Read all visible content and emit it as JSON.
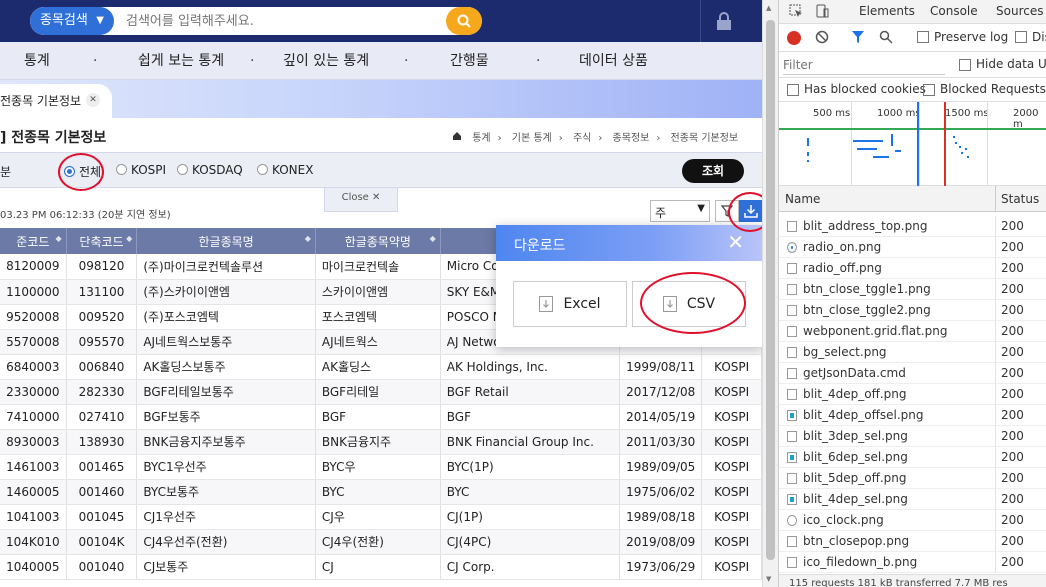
{
  "topbar": {
    "search_type": "종목검색",
    "search_placeholder": "검색어를 입력해주세요."
  },
  "gnb": {
    "items": [
      "통계",
      "쉽게 보는 통계",
      "깊이 있는 통계",
      "간행물",
      "데이터 상품"
    ],
    "dot": "·"
  },
  "tab": {
    "label": "전종목 기본정보"
  },
  "title": {
    "text": "] 전종목 기본정보",
    "breadcrumb": [
      "통계",
      "기본 통계",
      "주식",
      "종목정보",
      "전종목 기본정보"
    ]
  },
  "filter": {
    "label": "분",
    "options": [
      "전체",
      "KOSPI",
      "KOSDAQ",
      "KONEX"
    ],
    "selected": "전체",
    "submit": "조회"
  },
  "close_tab": {
    "label": "Close"
  },
  "info": {
    "timestamp": "03.23 PM 06:12:33 (20분 지연 정보)",
    "unit": "주"
  },
  "table": {
    "headers": [
      "준코드",
      "단축코드",
      "한글종목명",
      "한글종목약명",
      "",
      "",
      ""
    ],
    "rows": [
      [
        "8120009",
        "098120",
        "(주)마이크로컨텍솔루션",
        "마이크로컨텍솔",
        "Micro Con",
        "",
        ""
      ],
      [
        "1100000",
        "131100",
        "(주)스카이이앤엠",
        "스카이이앤엠",
        "SKY E&M",
        "",
        ""
      ],
      [
        "9520008",
        "009520",
        "(주)포스코엠텍",
        "포스코엠텍",
        "POSCO M",
        "",
        ""
      ],
      [
        "5570008",
        "095570",
        "AJ네트웍스보통주",
        "AJ네트웍스",
        "AJ Networ",
        "",
        ""
      ],
      [
        "6840003",
        "006840",
        "AK홀딩스보통주",
        "AK홀딩스",
        "AK Holdings, Inc.",
        "1999/08/11",
        "KOSPI"
      ],
      [
        "2330000",
        "282330",
        "BGF리테일보통주",
        "BGF리테일",
        "BGF Retail",
        "2017/12/08",
        "KOSPI"
      ],
      [
        "7410000",
        "027410",
        "BGF보통주",
        "BGF",
        "BGF",
        "2014/05/19",
        "KOSPI"
      ],
      [
        "8930003",
        "138930",
        "BNK금융지주보통주",
        "BNK금융지주",
        "BNK Financial Group Inc.",
        "2011/03/30",
        "KOSPI"
      ],
      [
        "1461003",
        "001465",
        "BYC1우선주",
        "BYC우",
        "BYC(1P)",
        "1989/09/05",
        "KOSPI"
      ],
      [
        "1460005",
        "001460",
        "BYC보통주",
        "BYC",
        "BYC",
        "1975/06/02",
        "KOSPI"
      ],
      [
        "1041003",
        "001045",
        "CJ1우선주",
        "CJ우",
        "CJ(1P)",
        "1989/08/18",
        "KOSPI"
      ],
      [
        "104K010",
        "00104K",
        "CJ4우선주(전환)",
        "CJ4우(전환)",
        "CJ(4PC)",
        "2019/08/09",
        "KOSPI"
      ],
      [
        "1040005",
        "001040",
        "CJ보통주",
        "CJ",
        "CJ Corp.",
        "1973/06/29",
        "KOSPI"
      ]
    ]
  },
  "popup": {
    "title": "다운로드",
    "close": "✕",
    "excel": "Excel",
    "csv": "CSV"
  },
  "devtools": {
    "tabs": [
      "Elements",
      "Console",
      "Sources"
    ],
    "preserve_log": "Preserve log",
    "disable_cache": "Disa",
    "filter_placeholder": "Filter",
    "hide_data_urls": "Hide data UR",
    "has_blocked_cookies": "Has blocked cookies",
    "blocked_requests": "Blocked Requests",
    "ticks": [
      "500 ms",
      "1000 ms",
      "1500 ms",
      "2000 m"
    ],
    "col_name": "Name",
    "col_status": "Status",
    "requests": [
      {
        "name": "blit_address_top.png",
        "status": "200"
      },
      {
        "name": "radio_on.png",
        "status": "200"
      },
      {
        "name": "radio_off.png",
        "status": "200"
      },
      {
        "name": "btn_close_tggle1.png",
        "status": "200"
      },
      {
        "name": "btn_close_tggle2.png",
        "status": "200"
      },
      {
        "name": "webponent.grid.flat.png",
        "status": "200"
      },
      {
        "name": "bg_select.png",
        "status": "200"
      },
      {
        "name": "getJsonData.cmd",
        "status": "200"
      },
      {
        "name": "blit_4dep_off.png",
        "status": "200"
      },
      {
        "name": "blit_4dep_offsel.png",
        "status": "200"
      },
      {
        "name": "blit_3dep_sel.png",
        "status": "200"
      },
      {
        "name": "blit_6dep_sel.png",
        "status": "200"
      },
      {
        "name": "blit_5dep_off.png",
        "status": "200"
      },
      {
        "name": "blit_4dep_sel.png",
        "status": "200"
      },
      {
        "name": "ico_clock.png",
        "status": "200"
      },
      {
        "name": "btn_closepop.png",
        "status": "200"
      },
      {
        "name": "ico_filedown_b.png",
        "status": "200"
      }
    ],
    "status_bar": "115 requests   181 kB transferred   7.7 MB res"
  },
  "colors": {
    "topbar": "#1c2b6e",
    "accent_blue": "#2e6fd8",
    "search_orange": "#f5a81c",
    "header_row": "#6b7aa6",
    "annotation_red": "#e0102b"
  }
}
